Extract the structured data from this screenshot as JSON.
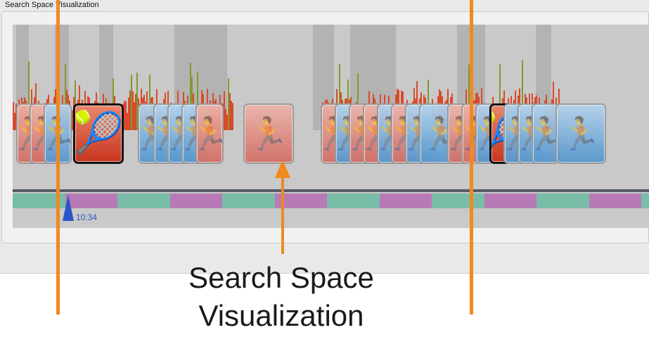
{
  "window": {
    "title": "Search Space Visualization"
  },
  "timeline": {
    "marker_time": "10:34",
    "histogram_colors": {
      "low": "#d94a2c",
      "high": "#7f9a2f"
    },
    "segment_colors": [
      "#79bda8",
      "#b87ab7"
    ],
    "thumbnail_frames": [
      {
        "name": "thumb-01",
        "tone": "red",
        "icon": "person-figure-icon"
      },
      {
        "name": "thumb-02",
        "tone": "red",
        "icon": "person-figure-icon"
      },
      {
        "name": "thumb-03",
        "tone": "blue",
        "icon": "person-figure-icon"
      },
      {
        "name": "thumb-selected",
        "tone": "selected",
        "icon": "tennis-player-icon"
      },
      {
        "name": "thumb-05",
        "tone": "blue",
        "icon": "person-figure-icon"
      },
      {
        "name": "thumb-06",
        "tone": "blue",
        "icon": "person-figure-icon"
      },
      {
        "name": "thumb-07",
        "tone": "blue",
        "icon": "person-figure-icon"
      },
      {
        "name": "thumb-08",
        "tone": "blue",
        "icon": "person-figure-icon"
      },
      {
        "name": "thumb-09",
        "tone": "red",
        "icon": "person-figure-icon"
      },
      {
        "name": "thumb-10",
        "tone": "red",
        "icon": "person-figure-icon"
      },
      {
        "name": "thumb-11",
        "tone": "red",
        "icon": "person-figure-icon"
      },
      {
        "name": "thumb-12",
        "tone": "blue",
        "icon": "person-figure-icon"
      },
      {
        "name": "thumb-13",
        "tone": "red",
        "icon": "person-figure-icon"
      },
      {
        "name": "thumb-14",
        "tone": "red",
        "icon": "person-figure-icon"
      },
      {
        "name": "thumb-15",
        "tone": "blue",
        "icon": "person-figure-icon"
      },
      {
        "name": "thumb-16",
        "tone": "red",
        "icon": "person-figure-icon"
      },
      {
        "name": "thumb-17",
        "tone": "blue",
        "icon": "person-figure-icon"
      },
      {
        "name": "thumb-18",
        "tone": "blue",
        "icon": "person-figure-icon"
      }
    ]
  },
  "annotation": {
    "line1": "Search Space",
    "line2": "Visualization",
    "color": "#ee8a1f"
  }
}
